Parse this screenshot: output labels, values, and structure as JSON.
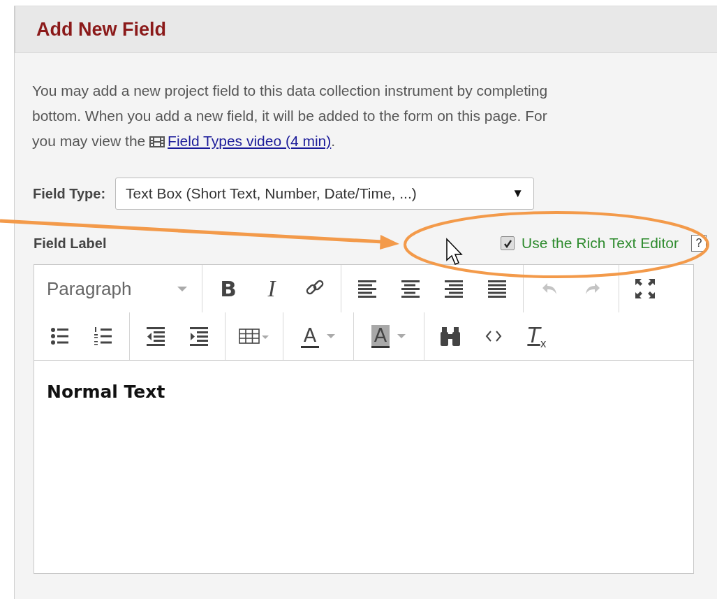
{
  "panel": {
    "title": "Add New Field"
  },
  "description": {
    "lines": [
      "You may add a new project field to this data collection instrument by completing",
      "bottom. When you add a new field, it will be added to the form on this page. For",
      "you may view the"
    ],
    "link": "Field Types video (4 min)",
    "end": "."
  },
  "field_type": {
    "label": "Field Type:",
    "value": "Text Box (Short Text, Number, Date/Time, ...)",
    "caret": "▼"
  },
  "field_label": {
    "label": "Field Label",
    "rich_text_checkbox": {
      "label": "Use the Rich Text Editor",
      "checked": true
    },
    "help": "?"
  },
  "editor": {
    "format": "Paragraph",
    "toolbar": [
      [
        [
          {
            "kind": "format"
          }
        ],
        [
          {
            "kind": "bold",
            "label": "B",
            "disabled": false
          },
          {
            "kind": "italic",
            "label": "I",
            "disabled": false
          },
          {
            "kind": "link",
            "disabled": false
          }
        ],
        [
          {
            "kind": "align-left",
            "disabled": false
          },
          {
            "kind": "align-center",
            "disabled": false
          },
          {
            "kind": "align-right",
            "disabled": false
          },
          {
            "kind": "justify",
            "disabled": false
          }
        ],
        [
          {
            "kind": "undo",
            "disabled": true
          },
          {
            "kind": "redo",
            "disabled": true
          }
        ],
        [
          {
            "kind": "fullscreen",
            "disabled": false
          }
        ]
      ],
      [
        [
          {
            "kind": "bullets",
            "disabled": false
          },
          {
            "kind": "numbers",
            "disabled": false
          }
        ],
        [
          {
            "kind": "outdent",
            "disabled": false
          },
          {
            "kind": "indent",
            "disabled": false
          }
        ],
        [
          {
            "kind": "table",
            "disabled": false
          }
        ],
        [
          {
            "kind": "text-color",
            "label": "A",
            "disabled": false
          }
        ],
        [
          {
            "kind": "background-color",
            "label": "A",
            "disabled": false
          }
        ],
        [
          {
            "kind": "find",
            "disabled": false
          },
          {
            "kind": "code",
            "disabled": false
          },
          {
            "kind": "clear-format",
            "label": "T$_{x}$",
            "disabled": false
          }
        ]
      ]
    ],
    "content": "Normal Text"
  }
}
